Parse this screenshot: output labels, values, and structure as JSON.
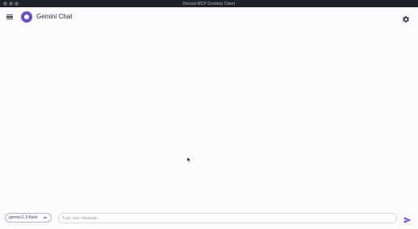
{
  "window": {
    "title": "Devoid MCP Desktop Client"
  },
  "header": {
    "menu_icon": "hamburger-menu-icon",
    "logo_icon": "gemini-logo-icon",
    "title": "Gemini Chat",
    "settings_icon": "gear-icon"
  },
  "composer": {
    "model": "gemini-1.5-flash",
    "placeholder": "Type your message...",
    "send_icon": "send-icon"
  },
  "colors": {
    "accent": "#6a4fc3",
    "background": "#fbfbfd",
    "titlebar": "#1f2128"
  }
}
